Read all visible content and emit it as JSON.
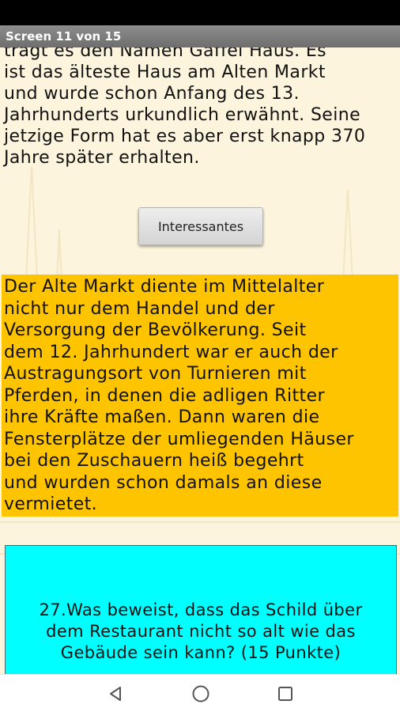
{
  "title_bar": {
    "title": "Screen 11 von 15"
  },
  "intro": {
    "text": "trägt es den Namen Gaffel Haus. Es\nist das älteste Haus am Alten Markt\nund wurde schon Anfang des 13.\nJahrhunderts urkundlich erwähnt. Seine\njetzige Form hat es aber erst knapp 370\nJahre später erhalten."
  },
  "button": {
    "label": "Interessantes"
  },
  "info_box": {
    "text": "Der Alte Markt diente im Mittelalter\nnicht nur dem Handel und der\nVersorgung der Bevölkerung. Seit\ndem 12. Jahrhundert war er auch der\nAustragungsort von Turnieren mit\nPferden, in denen die adligen Ritter\nihre Kräfte maßen. Dann waren die\nFensterplätze der umliegenden Häuser\nbei den Zuschauern heiß begehrt\nund wurden schon damals an diese\nvermietet.",
    "color": "#ffc400"
  },
  "question_box": {
    "text": "27.Was beweist, dass das Schild über\ndem Restaurant nicht so alt wie das\nGebäude sein kann? (15 Punkte)",
    "color": "#00ffff"
  },
  "nav_bar": {
    "back_icon": "back-triangle-icon",
    "home_icon": "home-circle-icon",
    "recents_icon": "recents-square-icon"
  }
}
